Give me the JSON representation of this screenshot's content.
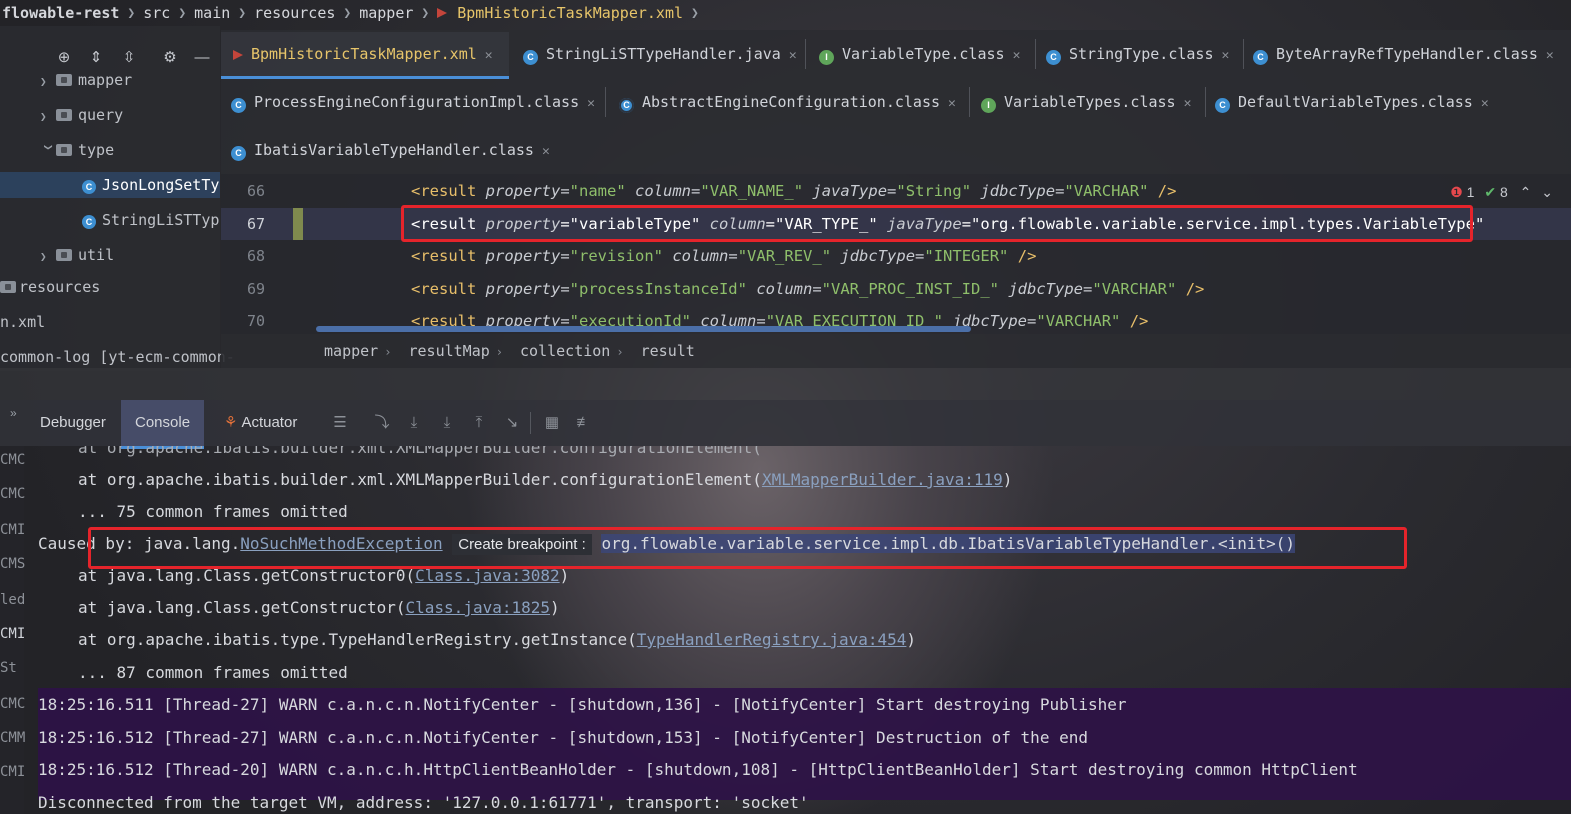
{
  "topbar": {
    "project": "flowable-rest",
    "crumbs": [
      "src",
      "main",
      "resources",
      "mapper"
    ],
    "file": "BpmHistoricTaskMapper.xml"
  },
  "project_tree": {
    "items": [
      {
        "label": "mapper",
        "type": "folder"
      },
      {
        "label": "query",
        "type": "folder"
      },
      {
        "label": "type",
        "type": "folder-open"
      },
      {
        "label": "JsonLongSetTy",
        "type": "class"
      },
      {
        "label": "StringLiSTTyp",
        "type": "class"
      },
      {
        "label": "util",
        "type": "folder"
      }
    ],
    "tail": [
      "resources",
      "n.xml",
      "common-log [yt-ecm-common-"
    ]
  },
  "editor_tabs": [
    {
      "label": "BpmHistoricTaskMapper.xml",
      "icon": "xml-icon",
      "active": true
    },
    {
      "label": "StringLiSTTypeHandler.java",
      "icon": "class-icon"
    },
    {
      "label": "VariableType.class",
      "icon": "interface-icon"
    },
    {
      "label": "StringType.class",
      "icon": "class-icon"
    },
    {
      "label": "ByteArrayRefTypeHandler.class",
      "icon": "class-icon"
    },
    {
      "label": "ProcessEngineConfigurationImpl.class",
      "icon": "class-icon"
    },
    {
      "label": "AbstractEngineConfiguration.class",
      "icon": "abstract-class-icon"
    },
    {
      "label": "VariableTypes.class",
      "icon": "interface-icon"
    },
    {
      "label": "DefaultVariableTypes.class",
      "icon": "class-icon"
    },
    {
      "label": "IbatisVariableTypeHandler.class",
      "icon": "class-icon"
    }
  ],
  "code": {
    "lines": [
      {
        "num": "66",
        "property": "name",
        "column": "VAR_NAME_",
        "javaType": "String",
        "jdbcType": "VARCHAR"
      },
      {
        "num": "67",
        "property": "variableType",
        "column": "VAR_TYPE_",
        "javaType": "org.flowable.variable.service.impl.types.VariableType"
      },
      {
        "num": "68",
        "property": "revision",
        "column": "VAR_REV_",
        "jdbcType": "INTEGER"
      },
      {
        "num": "69",
        "property": "processInstanceId",
        "column": "VAR_PROC_INST_ID_",
        "jdbcType": "VARCHAR"
      },
      {
        "num": "70",
        "property": "executionId",
        "column": "VAR_EXECUTION_ID_",
        "jdbcType": "VARCHAR"
      }
    ],
    "errors": "1",
    "warnings": "8"
  },
  "editor_breadcrumb": [
    "mapper",
    "resultMap",
    "collection",
    "result"
  ],
  "debug_tabs": [
    "Debugger",
    "Console",
    "Actuator"
  ],
  "console": {
    "lines": [
      {
        "text": "at org.apache.ibatis.builder.xml.XMLMapperBuilder.configurationElement(",
        "link": "XMLMapperBuilder.java:119",
        "end": ")"
      },
      {
        "text": "... 75 common frames omitted"
      },
      {
        "caused_prefix": "Caused by: java.lang.",
        "caused_link": "NoSuchMethodException",
        "chip": "Create breakpoint :",
        "message": "org.flowable.variable.service.impl.db.IbatisVariableTypeHandler.<init>()"
      },
      {
        "text": "at java.lang.Class.getConstructor0(",
        "link": "Class.java:3082",
        "end": ")"
      },
      {
        "text": "at java.lang.Class.getConstructor(",
        "link": "Class.java:1825",
        "end": ")"
      },
      {
        "text": "at org.apache.ibatis.type.TypeHandlerRegistry.getInstance(",
        "link": "TypeHandlerRegistry.java:454",
        "end": ")"
      },
      {
        "text": "... 87 common frames omitted"
      }
    ],
    "warns": [
      "18:25:16.511 [Thread-27] WARN  c.a.n.c.n.NotifyCenter - [shutdown,136] - [NotifyCenter] Start destroying Publisher",
      "18:25:16.512 [Thread-27] WARN  c.a.n.c.n.NotifyCenter - [shutdown,153] - [NotifyCenter] Destruction of the end",
      "18:25:16.512 [Thread-20] WARN  c.a.n.c.h.HttpClientBeanHolder - [shutdown,108] - [HttpClientBeanHolder] Start destroying common HttpClient"
    ],
    "disconnect": "Disconnected from the target VM, address: '127.0.0.1:61771', transport: 'socket'",
    "side_labels": [
      "CMC",
      "CMC",
      "CMI",
      "CMS",
      "led",
      "CMI",
      "St",
      "CMC",
      "CMM",
      "CMI"
    ]
  }
}
